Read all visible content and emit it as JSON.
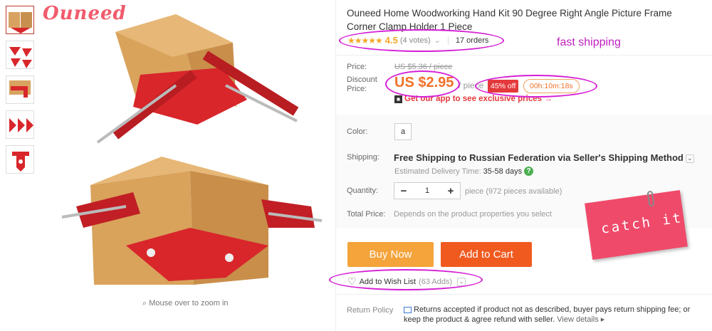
{
  "brand": "Ouneed",
  "product": {
    "title": "Ouneed Home Woodworking Hand Kit 90 Degree Right Angle Picture Frame Corner Clamp Holder 1 Piece",
    "stars": "★★★★★",
    "rating": "4.5",
    "votes": "(4 votes)",
    "orders": "17 orders"
  },
  "annotations": {
    "fast_shipping": "fast shipping",
    "catch_it": "catch it"
  },
  "price": {
    "label": "Price:",
    "old": "US $5.36 / piece",
    "discount_label": "Discount\nPrice:",
    "new": "US $2.95",
    "unit": "/ piece",
    "discount": "45% off",
    "timer": "00h:10m:18s",
    "app_promo": "Get our app to see exclusive prices →"
  },
  "options": {
    "color_label": "Color:",
    "color_value": "a",
    "shipping_label": "Shipping:",
    "shipping_text": "Free Shipping to Russian Federation via Seller's Shipping Method",
    "delivery_label": "Estimated Delivery Time:",
    "delivery_value": "35-58 days",
    "quantity_label": "Quantity:",
    "quantity_value": "1",
    "available": "piece (972 pieces available)",
    "total_label": "Total Price:",
    "total_note": "Depends on the product properties you select"
  },
  "actions": {
    "buy_now": "Buy Now",
    "add_to_cart": "Add to Cart",
    "wish_list": "Add to Wish List",
    "wish_count": "(63 Adds)"
  },
  "gallery": {
    "zoom_hint": "Mouse over to zoom in"
  },
  "return_policy": {
    "label": "Return Policy",
    "text": "Returns accepted if product not as described, buyer pays return shipping fee; or keep the product & agree refund with seller.",
    "view_details": "View details ▸"
  },
  "colors": {
    "accent_orange": "#f07128",
    "buy_button": "#f5a33b",
    "cart_button": "#f05a1f",
    "annotation_magenta": "#d51fd5",
    "clamp_red": "#d8262b"
  },
  "icons": [
    "magnifier-icon",
    "heart-plus-icon",
    "qr-code-icon",
    "help-icon",
    "chevron-down-icon",
    "return-shield-icon"
  ]
}
